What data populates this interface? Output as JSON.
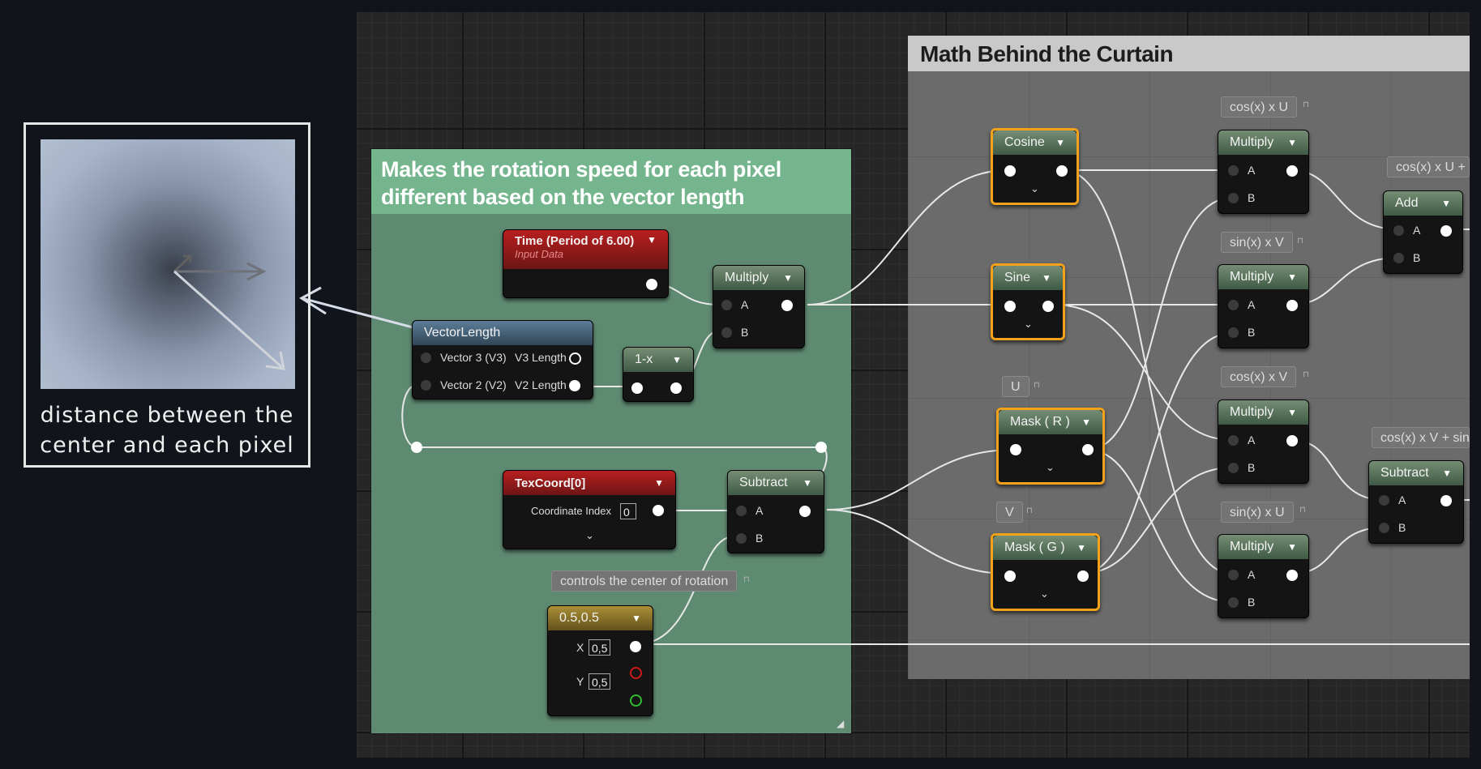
{
  "annotation": {
    "caption_line1": "distance between the",
    "caption_line2": "center and each pixel"
  },
  "comments": {
    "left_title_line1": "Makes the rotation speed for each pixel",
    "left_title_line2": "different based on the vector length",
    "right_title": "Math Behind the Curtain"
  },
  "nodes": {
    "time": {
      "title": "Time (Period of 6.00)",
      "subtitle": "Input Data"
    },
    "vectorlength": {
      "title": "VectorLength",
      "v3_in": "Vector 3 (V3)",
      "v3_out": "V3 Length",
      "v2_in": "Vector 2 (V2)",
      "v2_out": "V2 Length"
    },
    "oneminusx": {
      "title": "1-x"
    },
    "multiply_left": {
      "title": "Multiply",
      "a": "A",
      "b": "B"
    },
    "texcoord": {
      "title": "TexCoord[0]",
      "coord_label": "Coordinate Index",
      "coord_value": "0"
    },
    "subtract_left": {
      "title": "Subtract",
      "a": "A",
      "b": "B"
    },
    "constant": {
      "title": "0.5,0.5",
      "x_label": "X",
      "x_value": "0,5",
      "y_label": "Y",
      "y_value": "0,5"
    },
    "cosine": {
      "title": "Cosine"
    },
    "sine": {
      "title": "Sine"
    },
    "mask_r": {
      "title": "Mask ( R )"
    },
    "mask_g": {
      "title": "Mask ( G )"
    },
    "multiply1": {
      "title": "Multiply",
      "a": "A",
      "b": "B"
    },
    "multiply2": {
      "title": "Multiply",
      "a": "A",
      "b": "B"
    },
    "multiply3": {
      "title": "Multiply",
      "a": "A",
      "b": "B"
    },
    "multiply4": {
      "title": "Multiply",
      "a": "A",
      "b": "B"
    },
    "add": {
      "title": "Add",
      "a": "A",
      "b": "B"
    },
    "subtract_right": {
      "title": "Subtract",
      "a": "A",
      "b": "B"
    }
  },
  "bubbles": {
    "center_note": "controls the center of rotation",
    "u": "U",
    "v": "V",
    "cos_u": "cos(x) x U",
    "sin_v": "sin(x) x V",
    "cos_v": "cos(x) x V",
    "sin_u": "sin(x) x U",
    "add_note": "cos(x) x U + s",
    "sub_note": "cos(x) x V + sin"
  },
  "colors": {
    "selected_outline": "#f4a21a",
    "green_comment": "#5f8a72",
    "gray_comment": "#6b6b6b"
  }
}
